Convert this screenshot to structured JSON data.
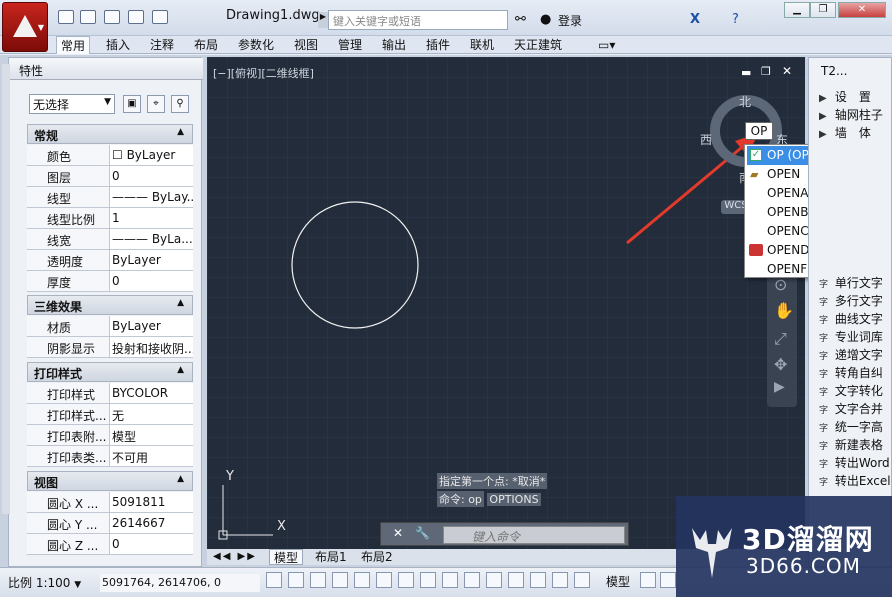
{
  "app": {
    "doc_title": "Drawing1.dwg",
    "search_placeholder": "键入关键字或短语",
    "login": "登录"
  },
  "ribbon": {
    "tabs": [
      "常用",
      "插入",
      "注释",
      "布局",
      "参数化",
      "视图",
      "管理",
      "输出",
      "插件",
      "联机",
      "天正建筑"
    ]
  },
  "properties": {
    "title": "特性",
    "selection": "无选择",
    "sections": {
      "general": {
        "title": "常规",
        "rows": [
          {
            "k": "颜色",
            "v": "☐ ByLayer"
          },
          {
            "k": "图层",
            "v": "0"
          },
          {
            "k": "线型",
            "v": "——— ByLay..."
          },
          {
            "k": "线型比例",
            "v": "1"
          },
          {
            "k": "线宽",
            "v": "——— ByLa..."
          },
          {
            "k": "透明度",
            "v": "ByLayer"
          },
          {
            "k": "厚度",
            "v": "0"
          }
        ]
      },
      "effects": {
        "title": "三维效果",
        "rows": [
          {
            "k": "材质",
            "v": "ByLayer"
          },
          {
            "k": "阴影显示",
            "v": "投射和接收阴..."
          }
        ]
      },
      "print": {
        "title": "打印样式",
        "rows": [
          {
            "k": "打印样式",
            "v": "BYCOLOR"
          },
          {
            "k": "打印样式...",
            "v": "无"
          },
          {
            "k": "打印表附...",
            "v": "模型"
          },
          {
            "k": "打印表类...",
            "v": "不可用"
          }
        ]
      },
      "view": {
        "title": "视图",
        "rows": [
          {
            "k": "圆心 X ...",
            "v": "5091811"
          },
          {
            "k": "圆心 Y ...",
            "v": "2614667"
          },
          {
            "k": "圆心 Z ...",
            "v": "0"
          }
        ]
      }
    }
  },
  "canvas": {
    "viewport_label": "[−][俯视][二维线框]",
    "compass": {
      "n": "北",
      "w": "西",
      "e": "东",
      "s": "南",
      "wcs": "WCS"
    },
    "axis": {
      "x": "X",
      "y": "Y"
    },
    "cmd_history": [
      "指定第一个点: *取消*",
      "命令: op",
      "OPTIONS"
    ],
    "cmd_placeholder": "键入命令",
    "op_tip": "OP"
  },
  "autocomplete": [
    "OP (OPTIONS)",
    "OPEN",
    "OPENALLLAYER",
    "OPENBEC_",
    "OPENCOORDINATE",
    "OPENDWFMARKUP",
    "OPENFROMCLOUD"
  ],
  "layout_tabs": [
    "模型",
    "布局1",
    "布局2"
  ],
  "status": {
    "scale": "比例 1:100",
    "coords": "5091764, 2614706, 0",
    "model": "模型"
  },
  "t2": {
    "title": "T2...",
    "top_items": [
      "设　置",
      "轴网柱子",
      "墙　体"
    ],
    "bottom_items": [
      "单行文字",
      "多行文字",
      "曲线文字",
      "专业词库",
      "递增文字",
      "转角自纠",
      "文字转化",
      "文字合并",
      "统一字高",
      "新建表格",
      "转出Word",
      "转出Excel"
    ]
  },
  "watermark": {
    "name": "3D溜溜网",
    "url": "3D66.COM"
  }
}
